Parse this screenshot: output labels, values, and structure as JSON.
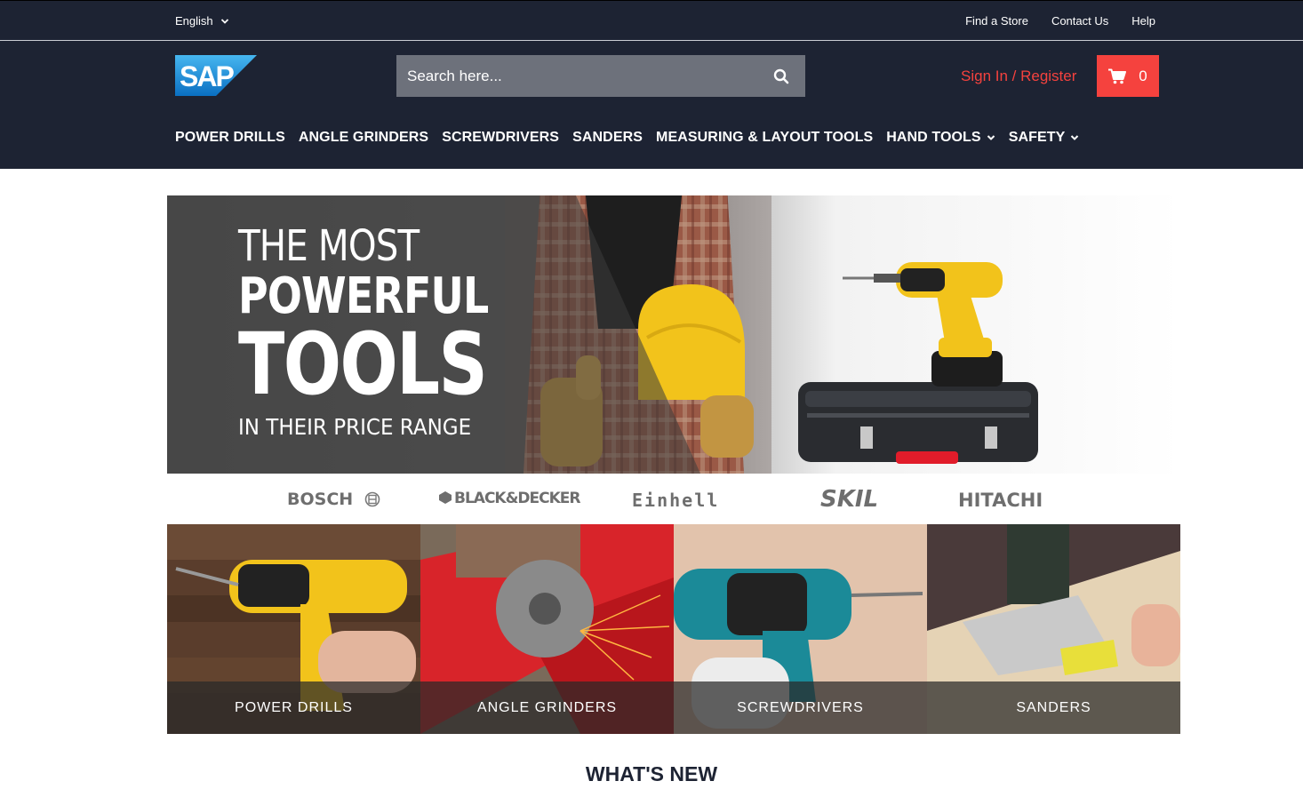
{
  "topbar": {
    "language": "English",
    "links": [
      "Find a Store",
      "Contact Us",
      "Help"
    ]
  },
  "header": {
    "logo_text": "SAP",
    "search_placeholder": "Search here...",
    "signin_label": "Sign In / Register",
    "cart_count": "0"
  },
  "nav": {
    "items": [
      {
        "label": "POWER DRILLS",
        "dropdown": false
      },
      {
        "label": "ANGLE GRINDERS",
        "dropdown": false
      },
      {
        "label": "SCREWDRIVERS",
        "dropdown": false
      },
      {
        "label": "SANDERS",
        "dropdown": false
      },
      {
        "label": "MEASURING & LAYOUT TOOLS",
        "dropdown": false
      },
      {
        "label": "HAND TOOLS",
        "dropdown": true
      },
      {
        "label": "SAFETY",
        "dropdown": true
      }
    ]
  },
  "hero": {
    "line1": "THE MOST",
    "line2": "POWERFUL",
    "line3": "TOOLS",
    "line4": "IN THEIR PRICE RANGE"
  },
  "brands": [
    "BOSCH",
    "BLACK&DECKER",
    "Einhell",
    "SKIL",
    "HITACHI"
  ],
  "categories": [
    "POWER DRILLS",
    "ANGLE GRINDERS",
    "SCREWDRIVERS",
    "SANDERS"
  ],
  "section_title": "WHAT'S NEW",
  "colors": {
    "header_bg": "#1d2333",
    "accent": "#f5423e",
    "search_bg": "#6d717b",
    "logo_blue": "#1f8fd8"
  },
  "icons": {
    "language_chevron": "chevron-down-icon",
    "search": "search-icon",
    "cart": "cart-icon"
  }
}
